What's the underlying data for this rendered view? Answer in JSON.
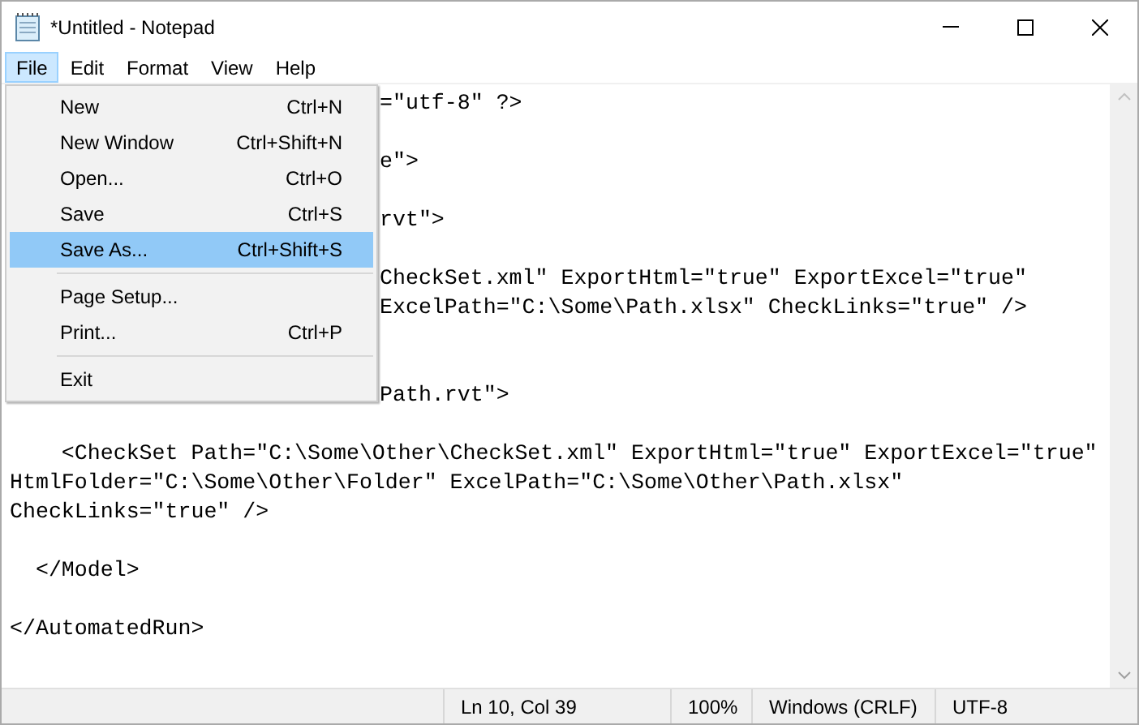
{
  "window": {
    "title": "*Untitled - Notepad"
  },
  "menu_bar": [
    {
      "label": "File",
      "selected": true
    },
    {
      "label": "Edit",
      "selected": false
    },
    {
      "label": "Format",
      "selected": false
    },
    {
      "label": "View",
      "selected": false
    },
    {
      "label": "Help",
      "selected": false
    }
  ],
  "file_menu": [
    {
      "kind": "item",
      "label": "New",
      "shortcut": "Ctrl+N",
      "selected": false
    },
    {
      "kind": "item",
      "label": "New Window",
      "shortcut": "Ctrl+Shift+N",
      "selected": false
    },
    {
      "kind": "item",
      "label": "Open...",
      "shortcut": "Ctrl+O",
      "selected": false
    },
    {
      "kind": "item",
      "label": "Save",
      "shortcut": "Ctrl+S",
      "selected": false
    },
    {
      "kind": "item",
      "label": "Save As...",
      "shortcut": "Ctrl+Shift+S",
      "selected": true
    },
    {
      "kind": "separator"
    },
    {
      "kind": "item",
      "label": "Page Setup...",
      "selected": false
    },
    {
      "kind": "item",
      "label": "Print...",
      "shortcut": "Ctrl+P",
      "selected": false
    },
    {
      "kind": "separator"
    },
    {
      "kind": "item",
      "label": "Exit",
      "selected": false
    }
  ],
  "editor_lines": [
    {
      "kind": "text",
      "text": "=\"utf-8\" ?>",
      "covered": true
    },
    {
      "kind": "blank"
    },
    {
      "kind": "text",
      "text": "e\">",
      "covered": true
    },
    {
      "kind": "blank"
    },
    {
      "kind": "text",
      "text": "rvt\">",
      "covered": true
    },
    {
      "kind": "blank"
    },
    {
      "kind": "text",
      "text": "CheckSet.xml\" ExportHtml=\"true\" ExportExcel=\"true\"",
      "covered": true
    },
    {
      "kind": "text",
      "text": "ExcelPath=\"C:\\Some\\Path.xlsx\" CheckLinks=\"true\" />",
      "covered": true
    },
    {
      "kind": "blank"
    },
    {
      "kind": "blank"
    },
    {
      "kind": "text",
      "text": "Path.rvt\">",
      "covered": true
    },
    {
      "kind": "blank"
    },
    {
      "kind": "text",
      "text": "    <CheckSet Path=\"C:\\Some\\Other\\CheckSet.xml\" ExportHtml=\"true\" ExportExcel=\"true\"",
      "covered": false
    },
    {
      "kind": "text",
      "text": "HtmlFolder=\"C:\\Some\\Other\\Folder\" ExcelPath=\"C:\\Some\\Other\\Path.xlsx\"",
      "covered": false
    },
    {
      "kind": "text",
      "text": "CheckLinks=\"true\" />",
      "covered": false
    },
    {
      "kind": "blank"
    },
    {
      "kind": "text",
      "text": "  </Model>",
      "covered": false
    },
    {
      "kind": "blank"
    },
    {
      "kind": "text",
      "text": "</AutomatedRun>",
      "covered": false
    }
  ],
  "status_bar": [
    "Ln 10, Col 39",
    "100%",
    "Windows (CRLF)",
    "UTF-8"
  ]
}
